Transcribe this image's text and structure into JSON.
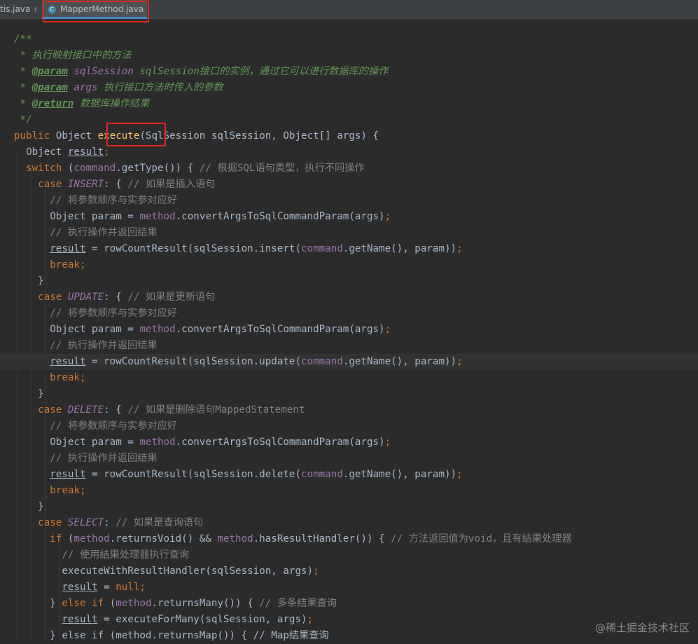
{
  "tabs": {
    "prev_label": "tis.java",
    "pin_glyph": "†",
    "active_label": "MapperMethod.java",
    "active_icon": "C"
  },
  "code": {
    "doc_open": "/**",
    "doc_desc": " * 执行映射接口中的方法",
    "doc_param_tag": "@param",
    "doc_param1_name": " sqlSession",
    "doc_param1_text": " sqlSession接口的实例，通过它可以进行数据库的操作",
    "doc_param2_name": " args",
    "doc_param2_text": " 执行接口方法时传入的参数",
    "doc_return_tag": "@return",
    "doc_return_text": " 数据库操作结果",
    "doc_close": " */",
    "kw_public": "public",
    "type_object": "Object",
    "method_execute": "execute",
    "sig_rest": "(SqlSession sqlSession, Object[] args) {",
    "var_result": "result",
    "kw_switch": "switch",
    "fld_command": "command",
    "switch_rest": ".getType()) { ",
    "cmt_switch": "// 根据SQL语句类型，执行不同操作",
    "kw_case": "case",
    "enum_insert": "INSERT",
    "enum_update": "UPDATE",
    "enum_delete": "DELETE",
    "enum_select": "SELECT",
    "cmt_insert": "// 如果是插入语句",
    "cmt_update": "// 如果是更新语句",
    "cmt_delete": "// 如果是删除语句MappedStatement",
    "cmt_select": "// 如果是查询语句",
    "cmt_convert": "// 将参数顺序与实参对应好",
    "cmt_exec": "// 执行操作并返回结果",
    "param_decl": "Object param = ",
    "fld_method": "method",
    "convert_call": ".convertArgsToSqlCommandParam(args)",
    "assign_rowcount": " = rowCountResult(sqlSession.",
    "op_insert": "insert",
    "op_update": "update",
    "op_delete": "delete",
    "getname_param": ".getName(), param))",
    "kw_break": "break",
    "brace_close": "}",
    "kw_if": "if",
    "returns_void": ".returnsVoid() && ",
    "has_handler": ".hasResultHandler()) { ",
    "cmt_void": "// 方法返回值为void，且有结果处理器",
    "cmt_use_handler": "// 使用结果处理器执行查询",
    "exec_handler": "executeWithResultHandler(sqlSession, args)",
    "kw_null": "null",
    "kw_else": "else",
    "returns_many": ".returnsMany()) { ",
    "cmt_many": "// 多条结果查询",
    "exec_many": " = executeForMany(sqlSession, args)",
    "partial_line": "} else if (method.returnsMap()) { // Map结果查询"
  },
  "watermark": "@稀土掘金技术社区"
}
